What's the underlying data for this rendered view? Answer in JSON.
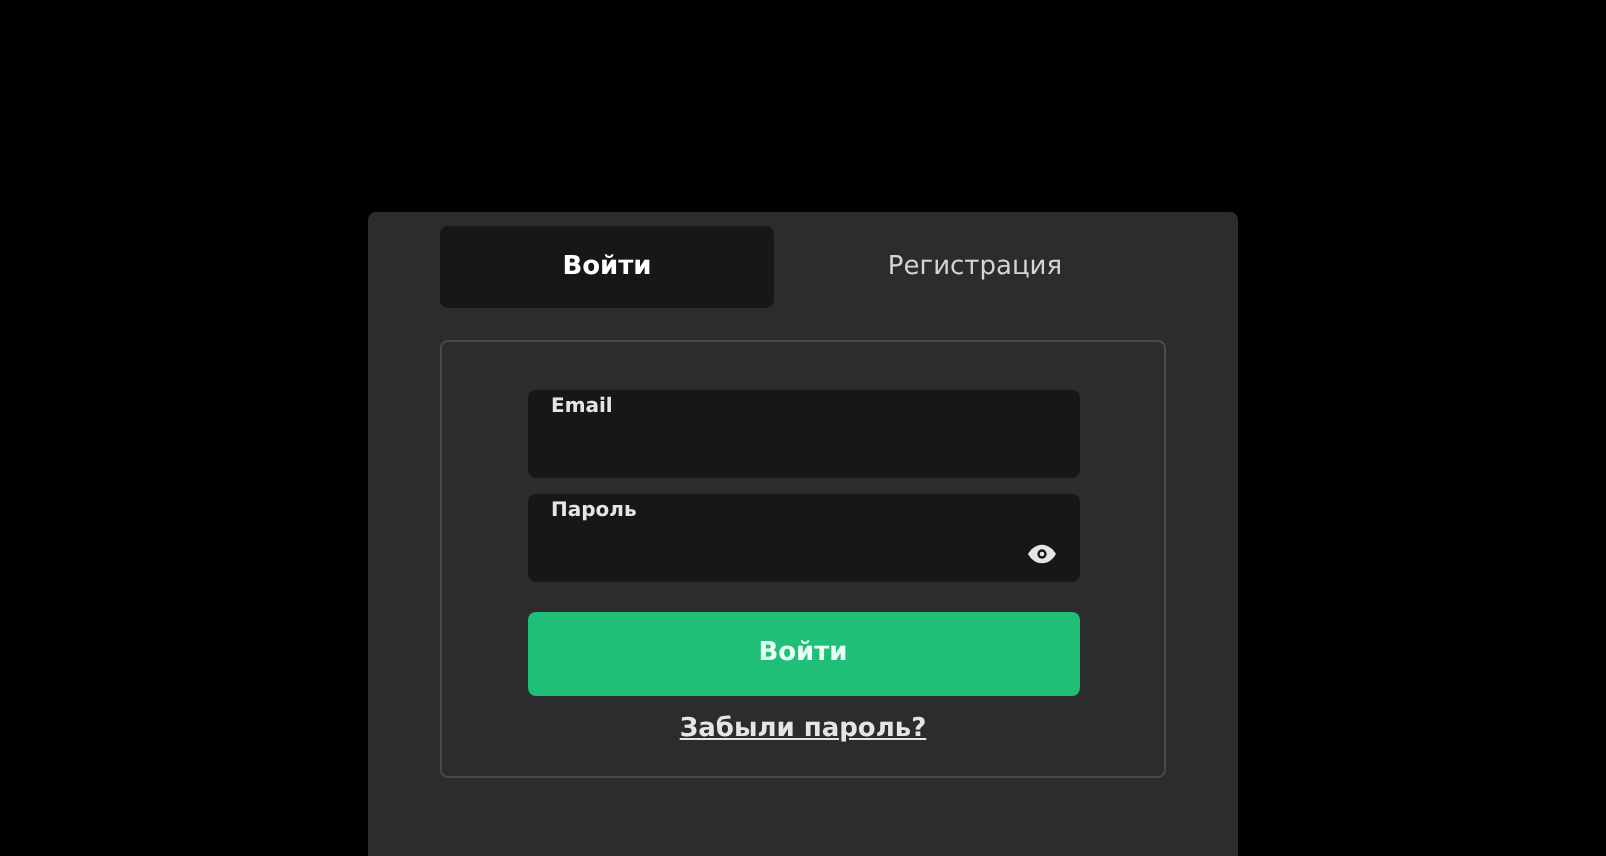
{
  "tabs": [
    {
      "label": "Войти",
      "selected": true
    },
    {
      "label": "Регистрация",
      "selected": false
    }
  ],
  "form": {
    "fields": [
      {
        "label": "Email",
        "reveal_icon": false
      },
      {
        "label": "Пароль",
        "reveal_icon": true
      }
    ],
    "submit": "Войти",
    "forgot_link": "Забыли пароль?"
  }
}
